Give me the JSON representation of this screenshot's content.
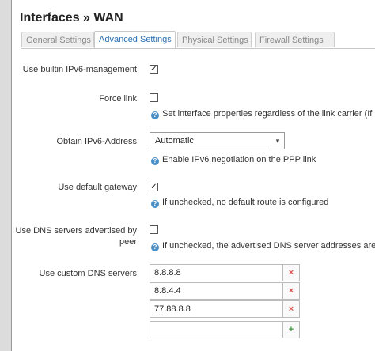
{
  "window": {
    "title": "Interfaces » WAN"
  },
  "tabs": [
    {
      "label": "General Settings",
      "active": false
    },
    {
      "label": "Advanced Settings",
      "active": true
    },
    {
      "label": "Physical Settings",
      "active": false
    },
    {
      "label": "Firewall Settings",
      "active": false
    }
  ],
  "fields": {
    "builtin_ipv6": {
      "label": "Use builtin IPv6-management",
      "checked": true
    },
    "force_link": {
      "label": "Force link",
      "checked": false,
      "help": "Set interface properties regardless of the link carrier (If se"
    },
    "obtain_ipv6": {
      "label": "Obtain IPv6-Address",
      "value": "Automatic",
      "help": "Enable IPv6 negotiation on the PPP link"
    },
    "default_gateway": {
      "label": "Use default gateway",
      "checked": true,
      "help": "If unchecked, no default route is configured"
    },
    "peer_dns": {
      "label": "Use DNS servers advertised by peer",
      "checked": false,
      "help": "If unchecked, the advertised DNS server addresses are ig"
    },
    "custom_dns": {
      "label": "Use custom DNS servers",
      "entries": [
        "8.8.8.8",
        "8.8.4.4",
        "77.88.8.8",
        ""
      ]
    }
  },
  "icons": {
    "checked_mark": "✓",
    "help": "?",
    "remove": "×",
    "add": "+",
    "dropdown": "▾"
  },
  "colors": {
    "active_tab_text": "#2a6fb0",
    "help_icon": "#4a90c8",
    "remove": "#d9534f",
    "add": "#3c9a3c"
  }
}
